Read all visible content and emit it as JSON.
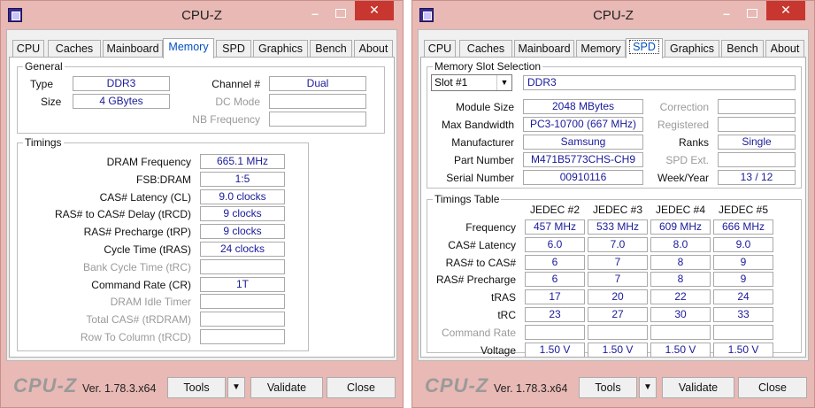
{
  "left": {
    "title": "CPU-Z",
    "tabs": [
      "CPU",
      "Caches",
      "Mainboard",
      "Memory",
      "SPD",
      "Graphics",
      "Bench",
      "About"
    ],
    "active_tab": "Memory",
    "general": {
      "label": "General",
      "type_label": "Type",
      "type": "DDR3",
      "size_label": "Size",
      "size": "4 GBytes",
      "channel_label": "Channel #",
      "channel": "Dual",
      "dc_mode_label": "DC Mode",
      "dc_mode": "",
      "nb_freq_label": "NB Frequency",
      "nb_freq": ""
    },
    "timings": {
      "label": "Timings",
      "rows": [
        {
          "label": "DRAM Frequency",
          "value": "665.1 MHz",
          "dim": false
        },
        {
          "label": "FSB:DRAM",
          "value": "1:5",
          "dim": false
        },
        {
          "label": "CAS# Latency (CL)",
          "value": "9.0 clocks",
          "dim": false
        },
        {
          "label": "RAS# to CAS# Delay (tRCD)",
          "value": "9 clocks",
          "dim": false
        },
        {
          "label": "RAS# Precharge (tRP)",
          "value": "9 clocks",
          "dim": false
        },
        {
          "label": "Cycle Time (tRAS)",
          "value": "24 clocks",
          "dim": false
        },
        {
          "label": "Bank Cycle Time (tRC)",
          "value": "",
          "dim": true
        },
        {
          "label": "Command Rate (CR)",
          "value": "1T",
          "dim": false
        },
        {
          "label": "DRAM Idle Timer",
          "value": "",
          "dim": true
        },
        {
          "label": "Total CAS# (tRDRAM)",
          "value": "",
          "dim": true
        },
        {
          "label": "Row To Column (tRCD)",
          "value": "",
          "dim": true
        }
      ]
    },
    "footer": {
      "brand": "CPU-Z",
      "version": "Ver. 1.78.3.x64",
      "tools": "Tools",
      "validate": "Validate",
      "close": "Close"
    }
  },
  "right": {
    "title": "CPU-Z",
    "tabs": [
      "CPU",
      "Caches",
      "Mainboard",
      "Memory",
      "SPD",
      "Graphics",
      "Bench",
      "About"
    ],
    "active_tab": "SPD",
    "slot": {
      "label": "Memory Slot Selection",
      "selected": "Slot #1",
      "type": "DDR3",
      "module_size_label": "Module Size",
      "module_size": "2048 MBytes",
      "max_bw_label": "Max Bandwidth",
      "max_bw": "PC3-10700 (667 MHz)",
      "manufacturer_label": "Manufacturer",
      "manufacturer": "Samsung",
      "part_label": "Part Number",
      "part": "M471B5773CHS-CH9",
      "serial_label": "Serial Number",
      "serial": "00910116",
      "correction_label": "Correction",
      "correction": "",
      "registered_label": "Registered",
      "registered": "",
      "ranks_label": "Ranks",
      "ranks": "Single",
      "spd_ext_label": "SPD Ext.",
      "spd_ext": "",
      "week_year_label": "Week/Year",
      "week_year": "13 / 12"
    },
    "timings_table": {
      "label": "Timings Table",
      "columns": [
        "JEDEC #2",
        "JEDEC #3",
        "JEDEC #4",
        "JEDEC #5"
      ],
      "rows": [
        {
          "label": "Frequency",
          "dim": false,
          "values": [
            "457 MHz",
            "533 MHz",
            "609 MHz",
            "666 MHz"
          ]
        },
        {
          "label": "CAS# Latency",
          "dim": false,
          "values": [
            "6.0",
            "7.0",
            "8.0",
            "9.0"
          ]
        },
        {
          "label": "RAS# to CAS#",
          "dim": false,
          "values": [
            "6",
            "7",
            "8",
            "9"
          ]
        },
        {
          "label": "RAS# Precharge",
          "dim": false,
          "values": [
            "6",
            "7",
            "8",
            "9"
          ]
        },
        {
          "label": "tRAS",
          "dim": false,
          "values": [
            "17",
            "20",
            "22",
            "24"
          ]
        },
        {
          "label": "tRC",
          "dim": false,
          "values": [
            "23",
            "27",
            "30",
            "33"
          ]
        },
        {
          "label": "Command Rate",
          "dim": true,
          "values": [
            "",
            "",
            "",
            ""
          ]
        },
        {
          "label": "Voltage",
          "dim": false,
          "values": [
            "1.50 V",
            "1.50 V",
            "1.50 V",
            "1.50 V"
          ]
        }
      ]
    },
    "footer": {
      "brand": "CPU-Z",
      "version": "Ver. 1.78.3.x64",
      "tools": "Tools",
      "validate": "Validate",
      "close": "Close"
    }
  }
}
